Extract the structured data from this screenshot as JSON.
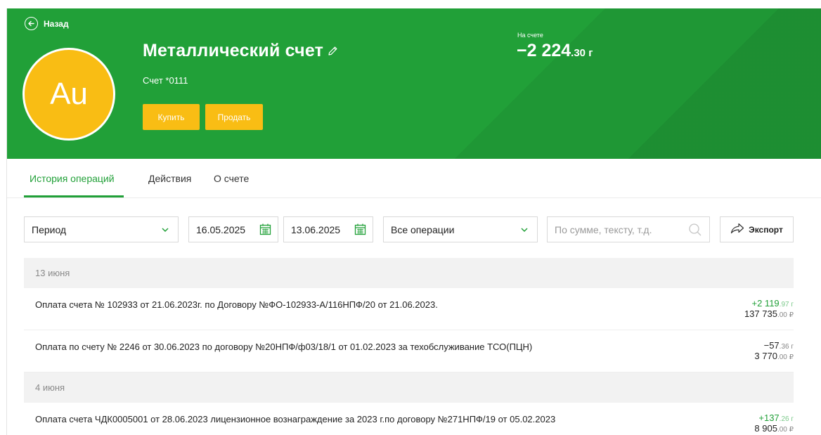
{
  "header": {
    "back_label": "Назад",
    "avatar_text": "Au",
    "title": "Металлический счет",
    "account_number": "Счет *0111",
    "buy_label": "Купить",
    "sell_label": "Продать",
    "balance_label": "На счете",
    "balance_int": "−2 224",
    "balance_frac": ".30 г",
    "colors": {
      "brand_green": "#21a038",
      "accent_yellow": "#f9bd14"
    }
  },
  "tabs": [
    {
      "label": "История операций",
      "active": true
    },
    {
      "label": "Действия",
      "active": false
    },
    {
      "label": "О счете",
      "active": false
    }
  ],
  "filters": {
    "period": "Период",
    "date_from": "16.05.2025",
    "date_to": "13.06.2025",
    "operation_type": "Все операции",
    "search_placeholder": "По сумме, тексту, т.д.",
    "export_label": "Экспорт"
  },
  "groups": [
    {
      "date": "13 июня",
      "operations": [
        {
          "description": "Оплата счета № 102933 от 21.06.2023г. по Договору №ФО-102933-А/116НПФ/20 от 21.06.2023.",
          "metal_int": "+2 119",
          "metal_frac": ".97 г",
          "rub_int": "137 735",
          "rub_frac": ".00 ₽",
          "positive": true
        },
        {
          "description": "Оплата по счету № 2246 от 30.06.2023 по договору №20НПФ/ф03/18/1 от 01.02.2023 за техобслуживание ТСО(ПЦН)",
          "metal_int": "−57",
          "metal_frac": ".36 г",
          "rub_int": "3 770",
          "rub_frac": ".00 ₽",
          "positive": false
        }
      ]
    },
    {
      "date": "4 июня",
      "operations": [
        {
          "description": "Оплата счета ЧДК0005001 от 28.06.2023 лицензионное вознаграждение за 2023 г.по договору №271НПФ/19 от 05.02.2023",
          "metal_int": "+137",
          "metal_frac": ".26 г",
          "rub_int": "8 905",
          "rub_frac": ".00 ₽",
          "positive": true
        }
      ]
    }
  ]
}
